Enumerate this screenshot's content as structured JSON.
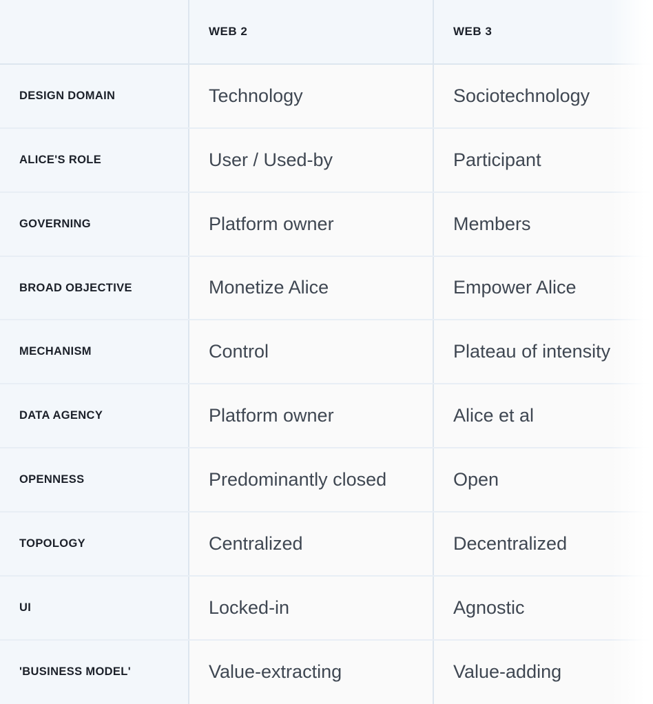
{
  "table": {
    "headers": [
      "",
      "WEB 2",
      "WEB 3"
    ],
    "rows": [
      {
        "label": "DESIGN DOMAIN",
        "web2": "Technology",
        "web3": "Sociotechnology"
      },
      {
        "label": "ALICE'S ROLE",
        "web2": "User / Used-by",
        "web3": "Participant"
      },
      {
        "label": "GOVERNING",
        "web2": "Platform owner",
        "web3": "Members"
      },
      {
        "label": "BROAD OBJECTIVE",
        "web2": "Monetize Alice",
        "web3": "Empower Alice"
      },
      {
        "label": "MECHANISM",
        "web2": "Control",
        "web3": "Plateau of intensity"
      },
      {
        "label": "DATA AGENCY",
        "web2": "Platform owner",
        "web3": "Alice et al"
      },
      {
        "label": "OPENNESS",
        "web2": "Predominantly closed",
        "web3": "Open"
      },
      {
        "label": "TOPOLOGY",
        "web2": "Centralized",
        "web3": "Decentralized"
      },
      {
        "label": "UI",
        "web2": "Locked-in",
        "web3": "Agnostic"
      },
      {
        "label": "'BUSINESS MODEL'",
        "web2": "Value-extracting",
        "web3": "Value-adding"
      }
    ]
  },
  "colors": {
    "label_column_bg": "#f3f7fb",
    "value_column_bg": "#fafafa",
    "border": "#dde6ef",
    "row_divider": "#e8eef5",
    "label_text": "#1b2029",
    "value_text": "#3f4752"
  }
}
